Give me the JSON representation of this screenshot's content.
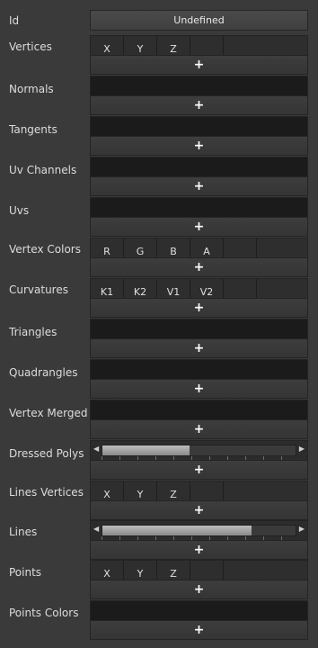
{
  "rows": {
    "id": {
      "label": "Id",
      "value": "Undefined"
    },
    "vertices": {
      "label": "Vertices",
      "columns": [
        "X",
        "Y",
        "Z",
        ""
      ]
    },
    "normals": {
      "label": "Normals"
    },
    "tangents": {
      "label": "Tangents"
    },
    "uv_channels": {
      "label": "Uv Channels"
    },
    "uvs": {
      "label": "Uvs"
    },
    "vertex_colors": {
      "label": "Vertex Colors",
      "columns": [
        "R",
        "G",
        "B",
        "A",
        ""
      ]
    },
    "curvatures": {
      "label": "Curvatures",
      "columns": [
        "K1",
        "K2",
        "V1",
        "V2",
        ""
      ]
    },
    "triangles": {
      "label": "Triangles"
    },
    "quadrangles": {
      "label": "Quadrangles"
    },
    "vertex_merged": {
      "label": "Vertex Merged"
    },
    "dressed_polys": {
      "label": "Dressed Polys",
      "scroll_fraction": 0.45
    },
    "lines_vertices": {
      "label": "Lines Vertices",
      "columns": [
        "X",
        "Y",
        "Z",
        ""
      ]
    },
    "lines": {
      "label": "Lines",
      "scroll_fraction": 0.77
    },
    "points": {
      "label": "Points",
      "columns": [
        "X",
        "Y",
        "Z",
        ""
      ]
    },
    "points_colors": {
      "label": "Points Colors"
    }
  },
  "add_symbol": "+",
  "icons": {
    "add": "plus-icon",
    "scroll_left": "arrow-left-icon",
    "scroll_right": "arrow-right-icon"
  }
}
